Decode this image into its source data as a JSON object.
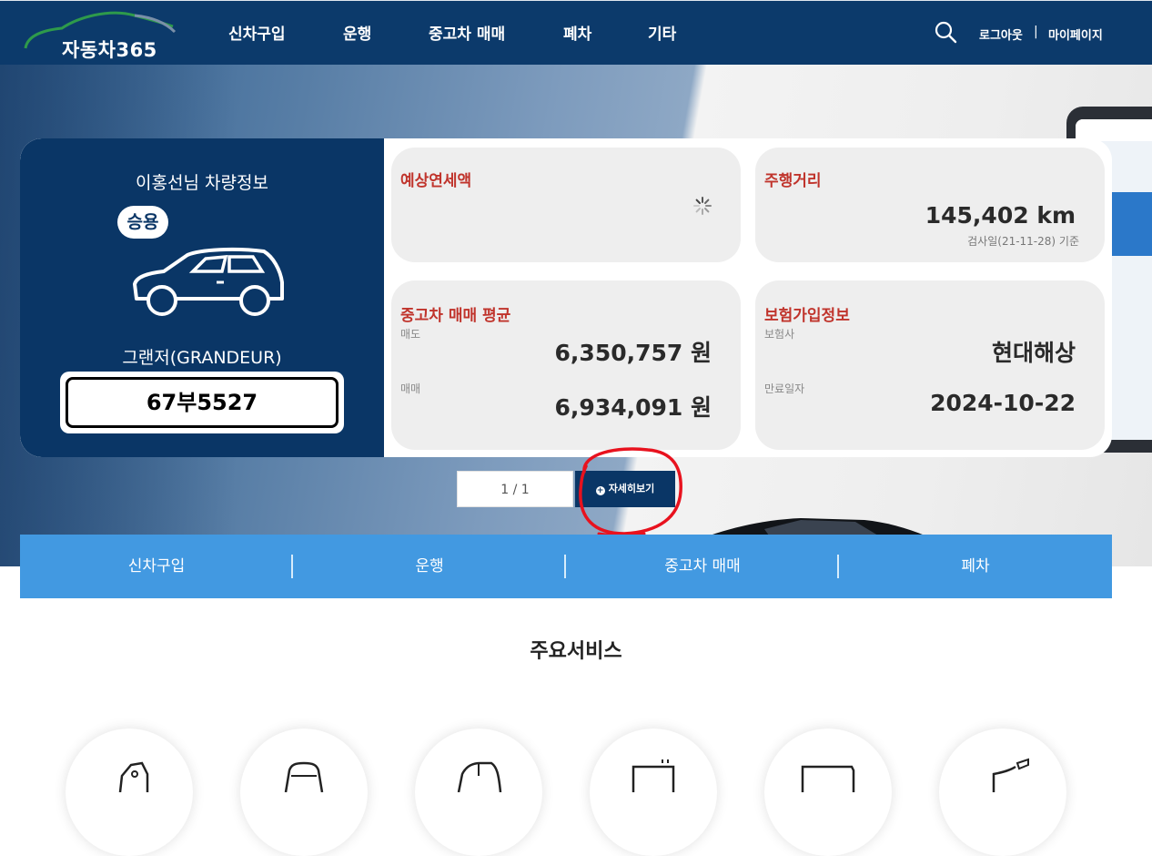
{
  "header": {
    "logo_text": "자동차365",
    "nav": [
      "신차구입",
      "운행",
      "중고차 매매",
      "폐차",
      "기타"
    ],
    "util": {
      "logout": "로그아웃",
      "separator": "|",
      "mypage": "마이페이지"
    }
  },
  "vehicle": {
    "owner_title": "이홍선님 차량정보",
    "type_badge": "승용",
    "model": "그랜저(GRANDEUR)",
    "plate": "67부5527"
  },
  "tiles": {
    "tax": {
      "title": "예상연세액"
    },
    "mileage": {
      "title": "주행거리",
      "value": "145,402 km",
      "note": "검사일(21-11-28) 기준"
    },
    "used_price": {
      "title": "중고차 매매 평균",
      "sell_label": "매도",
      "sell_value": "6,350,757 원",
      "trade_label": "매매",
      "trade_value": "6,934,091 원"
    },
    "insurance": {
      "title": "보험가입정보",
      "insurer_label": "보험사",
      "insurer_value": "현대해상",
      "expiry_label": "만료일자",
      "expiry_value": "2024-10-22"
    }
  },
  "pager": {
    "text": "1 / 1",
    "detail_button": "자세히보기"
  },
  "quickbar": [
    "신차구입",
    "운행",
    "중고차 매매",
    "폐차"
  ],
  "services": {
    "title": "주요서비스"
  },
  "colors": {
    "navy": "#0a3666",
    "header": "#0c3a6b",
    "accent_red": "#c0342c",
    "quick_blue": "#4299e1",
    "annotation": "#e8121e"
  }
}
